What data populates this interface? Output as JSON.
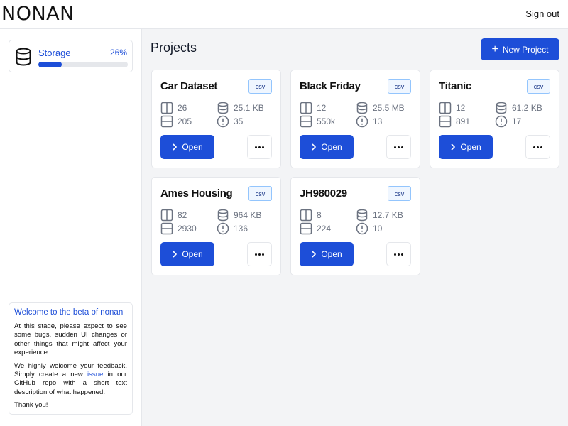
{
  "app": {
    "logo": "NONAN",
    "signout_label": "Sign out"
  },
  "sidebar": {
    "storage": {
      "label": "Storage",
      "percent_label": "26%",
      "percent": 26
    },
    "welcome": {
      "title": "Welcome to the beta of nonan",
      "p1": "At this stage, please expect to see some bugs, sudden UI changes or other things that might affect your experience.",
      "p2_before": "We highly welcome your feedback. Simply create a new ",
      "p2_link": "issue",
      "p2_after": " in our GitHub repo with a short text description of what happened.",
      "p3": "Thank you!"
    }
  },
  "main": {
    "title": "Projects",
    "new_project_label": "New Project",
    "open_label": "Open",
    "projects": [
      {
        "name": "Car Dataset",
        "type": "csv",
        "columns": "26",
        "rows": "205",
        "size": "25.1 KB",
        "issues": "35"
      },
      {
        "name": "Black Friday",
        "type": "csv",
        "columns": "12",
        "rows": "550k",
        "size": "25.5 MB",
        "issues": "13"
      },
      {
        "name": "Titanic",
        "type": "csv",
        "columns": "12",
        "rows": "891",
        "size": "61.2 KB",
        "issues": "17"
      },
      {
        "name": "Ames Housing",
        "type": "csv",
        "columns": "82",
        "rows": "2930",
        "size": "964 KB",
        "issues": "136"
      },
      {
        "name": "JH980029",
        "type": "csv",
        "columns": "8",
        "rows": "224",
        "size": "12.7 KB",
        "issues": "10"
      }
    ]
  },
  "colors": {
    "accent": "#1d4ed8",
    "badge_bg": "#eff6ff",
    "badge_border": "#93c5fd",
    "muted_text": "#6b7280"
  }
}
